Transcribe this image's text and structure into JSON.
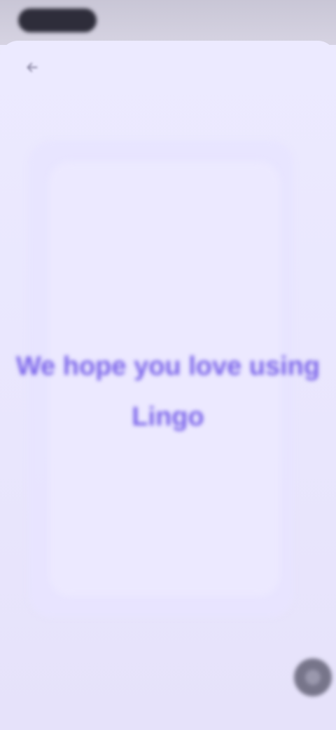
{
  "app": {
    "message": "We hope you love using Lingo"
  },
  "colors": {
    "accent": "#7b64ea",
    "background": "#e9e6fb",
    "status_bar": "#cfccdc",
    "fab": "#77758a"
  },
  "icons": {
    "back": "arrow-left-icon",
    "fab": "circle-action-icon"
  }
}
